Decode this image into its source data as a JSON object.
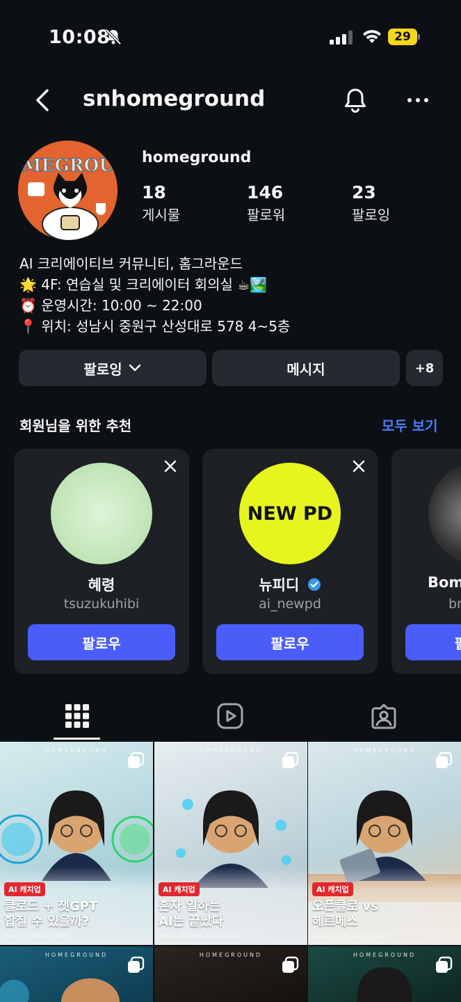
{
  "status_bar": {
    "time": "10:08",
    "battery": "29"
  },
  "header": {
    "username": "snhomeground"
  },
  "profile": {
    "display_name": "homeground",
    "avatar_text": "HOMEGROUND",
    "stats": [
      {
        "value": "18",
        "label": "게시물"
      },
      {
        "value": "146",
        "label": "팔로워"
      },
      {
        "value": "23",
        "label": "팔로잉"
      }
    ],
    "bio": [
      "AI 크리에이티브 커뮤니티, 홈그라운드",
      "🌟 4F: 연습실 및 크리에이터 회의실 ☕🏞️",
      "⏰ 운영시간: 10:00 ~ 22:00",
      "📍 위치: 성남시 중원구 산성대로 578 4~5층"
    ]
  },
  "actions": {
    "following_label": "팔로잉",
    "message_label": "메시지",
    "add_person_label": "+8"
  },
  "suggestions": {
    "title": "회원님을 위한 추천",
    "see_all": "모두 보기",
    "cards": [
      {
        "name": "혜령",
        "handle": "tsuzukuhibi",
        "follow": "팔로우"
      },
      {
        "name": "뉴피디",
        "handle": "ai_newpd",
        "follow": "팔로우",
        "pic_text": "NEW PD"
      },
      {
        "name": "Bom",
        "handle": "br",
        "follow": "팔"
      }
    ]
  },
  "posts": [
    {
      "brand": "HOMEGROUND",
      "tag": "AI 캐치업",
      "title": "클로드 + 챗GPT\n합칠 수 있을까?",
      "sub": "2026.07 · 아이템 AI들이 손잡는 법"
    },
    {
      "brand": "HOMEGROUND",
      "tag": "AI 캐치업",
      "title": "혼자 일하는\nAI는 끝났다",
      "sub": "2026.07 · 멀티에이전트, AI들이 팀을 이루다"
    },
    {
      "brand": "HOMEGROUND",
      "tag": "AI 캐치업",
      "title": "오픈클로 vs\n헤르메스",
      "sub": "2026.07 · 내 손안의 AI 비서, 뭐가 나을까"
    },
    {
      "brand": "HOMEGROUND"
    },
    {
      "brand": "HOMEGROUND"
    },
    {
      "brand": "HOMEGROUND"
    }
  ],
  "colors": {
    "background": "#0c1014",
    "accent": "#4a5df9",
    "link": "#4a7cff"
  }
}
